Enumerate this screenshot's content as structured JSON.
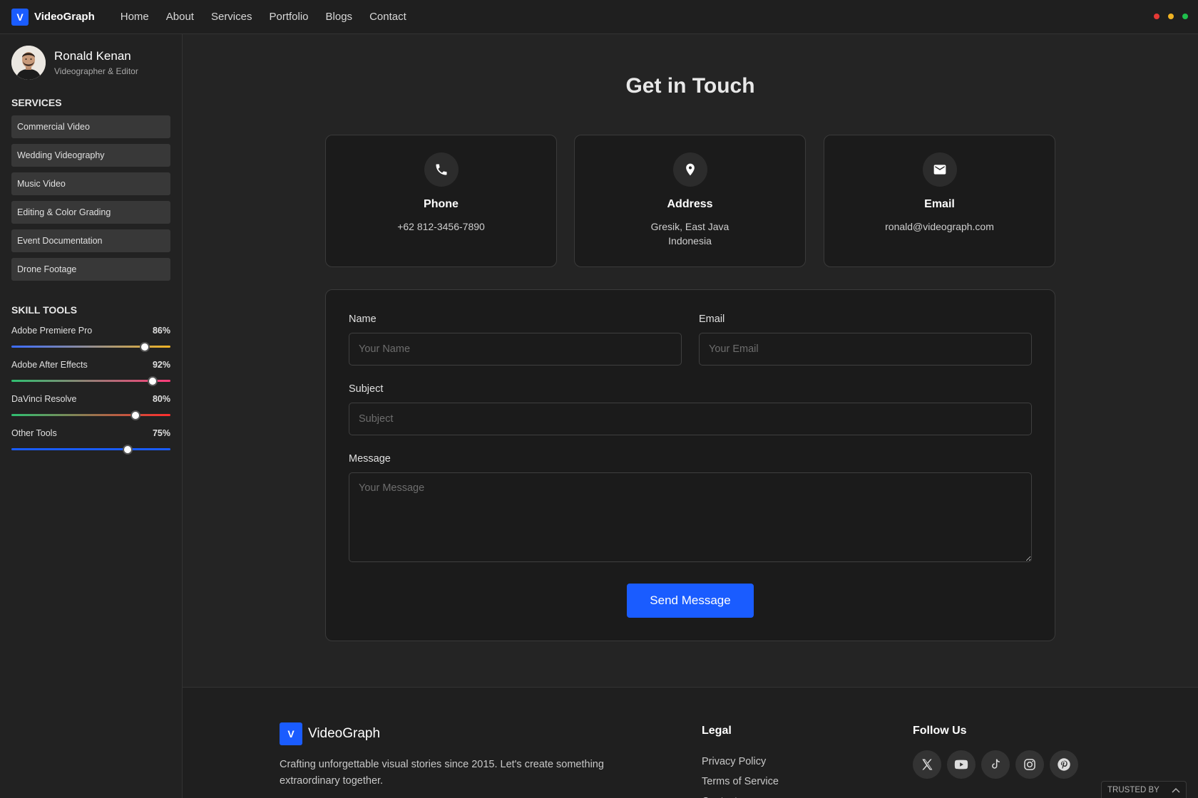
{
  "app": {
    "logo_letter": "V",
    "brand": "VideoGraph"
  },
  "nav": [
    {
      "label": "Home"
    },
    {
      "label": "About"
    },
    {
      "label": "Services"
    },
    {
      "label": "Portfolio"
    },
    {
      "label": "Blogs"
    },
    {
      "label": "Contact"
    }
  ],
  "window_dots": [
    "#e53935",
    "#f0b323",
    "#1fbf4c"
  ],
  "profile": {
    "name": "Ronald Kenan",
    "role": "Videographer & Editor"
  },
  "services": {
    "heading": "SERVICES",
    "items": [
      {
        "label": "Commercial Video"
      },
      {
        "label": "Wedding Videography"
      },
      {
        "label": "Music Video"
      },
      {
        "label": "Editing & Color Grading"
      },
      {
        "label": "Event Documentation"
      },
      {
        "label": "Drone Footage"
      }
    ]
  },
  "skills": {
    "heading": "SKILL TOOLS",
    "items": [
      {
        "name": "Adobe Premiere Pro",
        "percent_label": "86%",
        "value": 0.84,
        "gradient": [
          "#3b6cff",
          "#f0b323"
        ]
      },
      {
        "name": "Adobe After Effects",
        "percent_label": "92%",
        "value": 0.89,
        "gradient": [
          "#2fbf71",
          "#ff3b7a"
        ]
      },
      {
        "name": "DaVinci Resolve",
        "percent_label": "80%",
        "value": 0.78,
        "gradient": [
          "#2fbf71",
          "#ff2d2d"
        ]
      },
      {
        "name": "Other Tools",
        "percent_label": "75%",
        "value": 0.73,
        "gradient": [
          "#1a5cff",
          "#1a5cff"
        ]
      }
    ]
  },
  "contact": {
    "title": "Get in Touch",
    "cards": [
      {
        "icon": "phone-icon",
        "title": "Phone",
        "lines": [
          "+62 812-3456-7890"
        ]
      },
      {
        "icon": "location-pin-icon",
        "title": "Address",
        "lines": [
          "Gresik, East Java",
          "Indonesia"
        ]
      },
      {
        "icon": "mail-icon",
        "title": "Email",
        "lines": [
          "ronald@videograph.com"
        ]
      }
    ]
  },
  "form": {
    "name_label": "Name",
    "name_placeholder": "Your Name",
    "email_label": "Email",
    "email_placeholder": "Your Email",
    "subject_label": "Subject",
    "subject_placeholder": "Subject",
    "message_label": "Message",
    "message_placeholder": "Your Message",
    "submit_label": "Send Message"
  },
  "footer": {
    "brand": "VideoGraph",
    "description": "Crafting unforgettable visual stories since 2015. Let's create something extraordinary together.",
    "legal_heading": "Legal",
    "legal_links": [
      {
        "label": "Privacy Policy"
      },
      {
        "label": "Terms of Service"
      },
      {
        "label": "Contact"
      }
    ],
    "follow_heading": "Follow Us",
    "socials": [
      "x-icon",
      "youtube-icon",
      "tiktok-icon",
      "instagram-icon",
      "pinterest-icon"
    ],
    "trusted_label": "TRUSTED BY"
  },
  "colors": {
    "accent": "#1a5cff",
    "background": "#242424",
    "card": "#1b1b1b"
  }
}
